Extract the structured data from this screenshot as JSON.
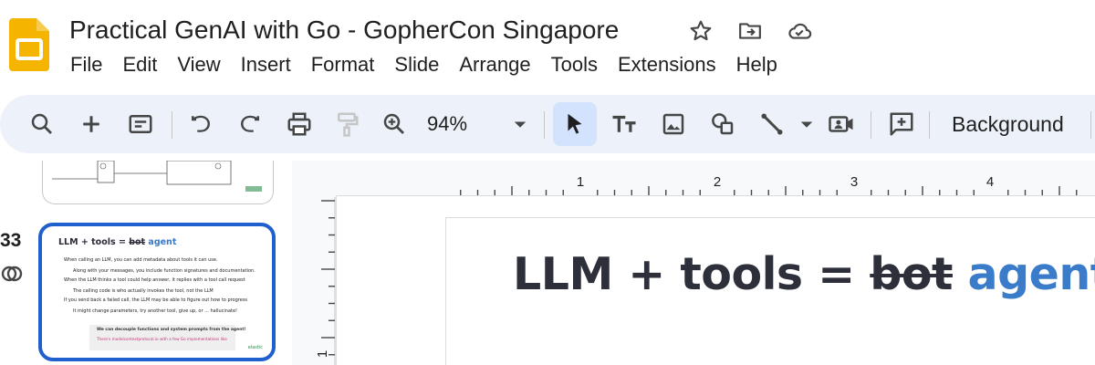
{
  "app": {
    "title": "Practical GenAI with Go - GopherCon Singapore",
    "icons": [
      "star-icon",
      "move-to-folder-icon",
      "cloud-saved-icon"
    ],
    "brand_color": "#f4b400"
  },
  "menu": [
    "File",
    "Edit",
    "View",
    "Insert",
    "Format",
    "Slide",
    "Arrange",
    "Tools",
    "Extensions",
    "Help"
  ],
  "toolbar": {
    "zoom": "94%",
    "background_label": "Background",
    "icons": [
      "search-icon",
      "new-slide-icon",
      "layout-icon",
      "undo-icon",
      "redo-icon",
      "print-icon",
      "paint-format-icon",
      "zoom-icon",
      "zoom-dropdown-icon",
      "select-icon",
      "text-box-icon",
      "image-icon",
      "shape-icon",
      "line-icon",
      "line-dropdown-icon",
      "video-icon",
      "comment-icon"
    ],
    "active_color": "#d3e3fd",
    "bar_color": "#edf2fa"
  },
  "ruler": {
    "h_labels": [
      "1",
      "2",
      "3",
      "4"
    ],
    "v_labels": [
      "1"
    ]
  },
  "filmstrip": {
    "current_number": "33",
    "selection_color": "#1f5fce",
    "current_slide": {
      "title_prefix": "LLM + tools = ",
      "title_strike": "bot",
      "title_accent": "agent",
      "lines": [
        "When calling an LLM, you can add metadata about tools it can use.",
        "Along with your messages, you include function signatures and documentation.",
        "When the LLM thinks a tool could help answer, it replies with a tool call request",
        "The calling code is who actually invokes the tool, not the LLM",
        "If you send back a failed call, the LLM may be able to figure out how to progress",
        "It might change parameters, try another tool, give up, or ... hallucinate!"
      ],
      "box_text": "We can decouple functions and system prompts from the agent!",
      "box_link": "There's modelcontextprotocol.io with a few Go implementations like",
      "logo": "elastic"
    }
  },
  "slide": {
    "title_prefix": "LLM + tools = ",
    "title_strike": "bot",
    "title_accent": "agent",
    "accent_color": "#3a7cc9"
  }
}
